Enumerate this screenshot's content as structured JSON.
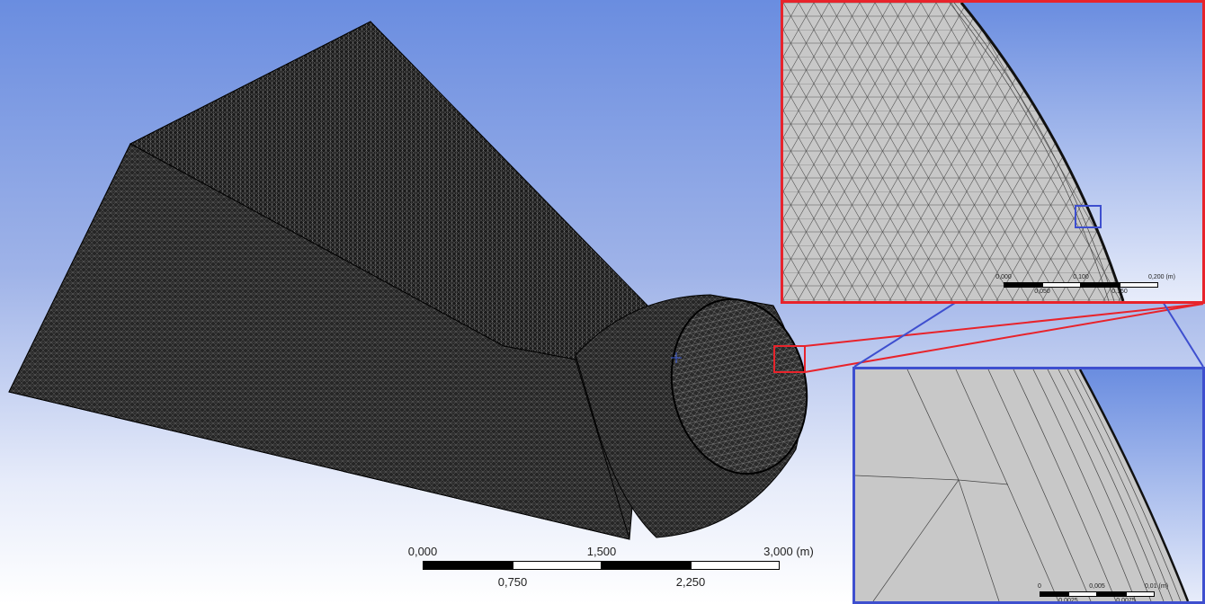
{
  "main_view": {
    "scale_bar": {
      "top_labels": [
        "0,000",
        "1,500",
        "3,000 (m)"
      ],
      "bottom_labels": [
        "0,750",
        "2,250"
      ]
    }
  },
  "zoom_inset_1": {
    "outline_color": "#e8232b",
    "scale_bar": {
      "top_labels": [
        "0,000",
        "0,100",
        "0,200 (m)"
      ],
      "bottom_labels": [
        "0,050",
        "0,150"
      ]
    }
  },
  "zoom_inset_2": {
    "outline_color": "#3e4fcf",
    "scale_bar": {
      "top_labels": [
        "0",
        "0,005",
        "0,01 (m)"
      ],
      "bottom_labels": [
        "0,0025",
        "0,0075"
      ]
    }
  },
  "colors": {
    "background_top": "#6a8de0",
    "background_bottom": "#ffffff",
    "mesh_dark": "#1e1e1e",
    "mesh_face_fill": "#c8c8c8"
  },
  "icons": [
    "triad-origin-icon"
  ]
}
